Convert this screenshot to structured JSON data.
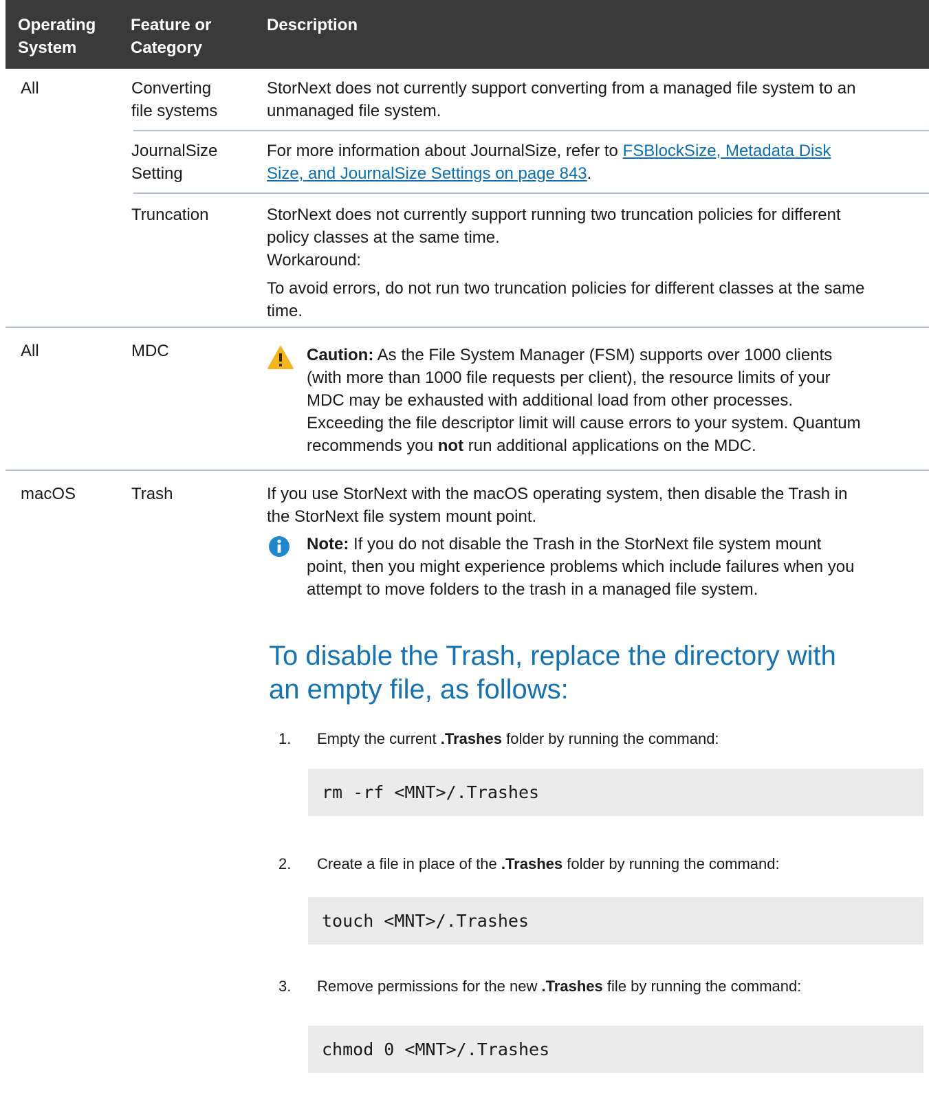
{
  "header": {
    "col_os": [
      "Operating",
      "System"
    ],
    "col_feature": [
      "Feature or",
      "Category"
    ],
    "col_desc": "Description"
  },
  "rows": {
    "r1": {
      "os": "All",
      "feature": [
        "Converting",
        "file systems"
      ],
      "desc": [
        "StorNext does not currently support converting from a managed file system to an",
        "unmanaged file system."
      ]
    },
    "r2": {
      "feature": [
        "JournalSize",
        "Setting"
      ],
      "desc_prefix": "For more information about JournalSize, refer to ",
      "link_line1": "FSBlockSize, Metadata Disk ",
      "link_line2": "Size, and JournalSize Settings on page 843",
      "desc_suffix": "."
    },
    "r3": {
      "feature": "Truncation",
      "desc": [
        "StorNext does not currently support running two truncation policies for different",
        "policy classes at the same time."
      ],
      "workaround_label": "Workaround:",
      "workaround": [
        "To avoid errors, do not run two truncation policies for different classes at the same",
        "time."
      ]
    },
    "r4": {
      "os": "All",
      "feature": "MDC",
      "caution_label": "Caution:",
      "caution": [
        " As the File System Manager (FSM) supports over 1000 clients",
        "(with more than 1000 file requests per client), the resource limits of your",
        "MDC may be exhausted with additional load from other processes.",
        "Exceeding the file descriptor limit will cause errors to your system. Quantum"
      ],
      "caution_last_pre": "recommends you ",
      "caution_last_bold": "not",
      "caution_last_post": " run additional applications on the MDC."
    },
    "r5": {
      "os": "macOS",
      "feature": "Trash",
      "desc": [
        "If you use StorNext with the macOS operating system, then disable the Trash in",
        "the StorNext file system mount point."
      ],
      "note_label": "Note:",
      "note": [
        " If you do not disable the Trash in the StorNext file system mount",
        "point, then you might experience problems which include failures when you",
        "attempt to move folders to the trash in a managed file system."
      ]
    }
  },
  "procedure": {
    "heading": [
      "To disable the Trash, replace the directory with",
      "an empty file, as follows:"
    ],
    "steps": [
      {
        "num": "1.",
        "pre": "Empty the current ",
        "bold": ".Trashes",
        "post": " folder by running the command:",
        "code": "rm -rf <MNT>/.Trashes"
      },
      {
        "num": "2.",
        "pre": "Create a file in place of the ",
        "bold": ".Trashes",
        "post": " folder by running the command:",
        "code": "touch <MNT>/.Trashes"
      },
      {
        "num": "3.",
        "pre": "Remove permissions for the new ",
        "bold": ".Trashes",
        "post": " file by running the command:",
        "code": "chmod 0 <MNT>/.Trashes"
      }
    ]
  },
  "colors": {
    "header_bg": "#3a3a3a",
    "link": "#0b6fb8",
    "heading": "#1473b5",
    "rule": "#b3bfcb",
    "code_bg": "#ebebeb",
    "caution": "#f3b61f",
    "note": "#1f87d0"
  }
}
